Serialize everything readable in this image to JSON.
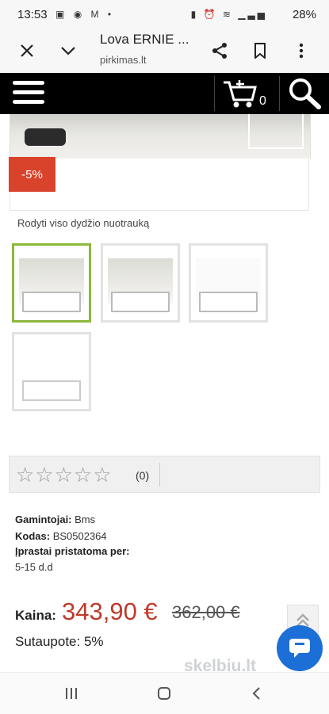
{
  "status_bar": {
    "time": "13:53",
    "battery": "28%",
    "notification_icons": [
      "image-icon",
      "messenger-icon",
      "gmail-icon",
      "dot-icon"
    ],
    "system_icons": [
      "battery-saver-icon",
      "alarm-icon",
      "wifi-icon",
      "signal-icon"
    ]
  },
  "browser": {
    "title": "Lova ERNIE ...",
    "url": "pirkimas.lt",
    "close_icon": "close-icon",
    "collapse_icon": "chevron-down-icon",
    "share_icon": "share-icon",
    "bookmark_icon": "bookmark-icon",
    "more_icon": "more-vert-icon"
  },
  "site_header": {
    "cart_count": "0",
    "menu_icon": "hamburger-icon",
    "cart_icon": "cart-icon",
    "search_icon": "search-icon"
  },
  "product": {
    "discount_badge": "-5%",
    "fullsize_link": "Rodyti viso dydžio nuotrauką",
    "thumbnails": [
      "thumbnail-1",
      "thumbnail-2",
      "thumbnail-3",
      "thumbnail-4"
    ],
    "rating": {
      "stars": 0,
      "max": 5,
      "count_text": "(0)"
    },
    "manufacturer_label": "Gamintojai:",
    "manufacturer_value": "Bms",
    "code_label": "Kodas:",
    "code_value": "BS0502364",
    "delivery_label": "Įprastai pristatoma per:",
    "delivery_value": "5-15 d.d",
    "price_label": "Kaina:",
    "price_new": "343,90 €",
    "price_old": "362,00 €",
    "saved_text": "Sutaupote: 5%"
  },
  "overlay": {
    "scroll_top_icon": "double-chevron-up-icon",
    "chat_icon": "chat-icon",
    "watermark": "skelbiu.lt"
  },
  "nav_bar": {
    "recents_icon": "recents-icon",
    "home_icon": "home-icon",
    "back_icon": "back-icon"
  },
  "colors": {
    "accent_price": "#c0392b",
    "discount_bg": "#d9432c",
    "active_thumb_border": "#8cb83a",
    "chat_button": "#1c6fd6",
    "header_bg": "#000000"
  }
}
